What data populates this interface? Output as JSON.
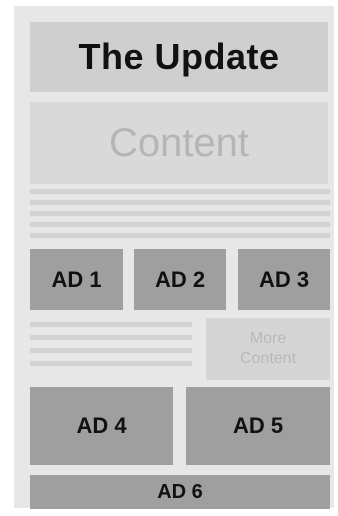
{
  "header": {
    "title": "The Update"
  },
  "content": {
    "label": "Content"
  },
  "ads": {
    "ad1": "AD 1",
    "ad2": "AD 2",
    "ad3": "AD 3",
    "ad4": "AD 4",
    "ad5": "AD 5",
    "ad6": "AD 6"
  },
  "more_content": {
    "line1": "More",
    "line2": "Content"
  },
  "colors": {
    "frame": "#e7e7e7",
    "header_bg": "#cfcfcf",
    "content_bg": "#d9d9d9",
    "ad_bg": "#9f9f9f",
    "placeholder_line": "#d3d3d3"
  }
}
